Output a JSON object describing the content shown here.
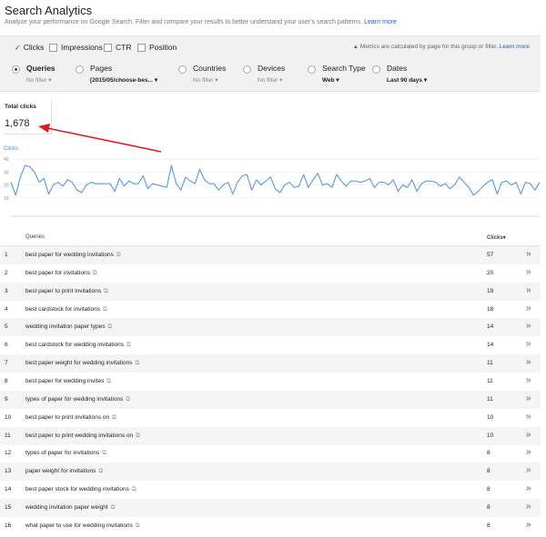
{
  "header": {
    "title": "Search Analytics",
    "subtitle": "Analyze your performance on Google Search. Filter and compare your results to better understand your user's search patterns.",
    "learn_more": "Learn more"
  },
  "metrics": {
    "clicks": "Clicks",
    "impressions": "Impressions",
    "ctr": "CTR",
    "position": "Position",
    "note": "Metrics are calculated by page for this group or filter.",
    "note_link": "Learn more"
  },
  "filters": {
    "queries": {
      "name": "Queries",
      "value": "No filter"
    },
    "pages": {
      "name": "Pages",
      "value": "[2015/05/choose-bes..."
    },
    "countries": {
      "name": "Countries",
      "value": "No filter"
    },
    "devices": {
      "name": "Devices",
      "value": "No filter"
    },
    "search_type": {
      "name": "Search Type",
      "value": "Web"
    },
    "dates": {
      "name": "Dates",
      "value": "Last 90 days"
    }
  },
  "total": {
    "label": "Total clicks",
    "value": "1,678"
  },
  "chart_data": {
    "type": "line",
    "ylabel": "Clicks",
    "yticks": [
      40,
      30,
      20,
      10
    ],
    "ylim": [
      0,
      40
    ],
    "series": [
      {
        "values": [
          22,
          12,
          26,
          35,
          34,
          30,
          22,
          25,
          13,
          20,
          22,
          19,
          24,
          22,
          16,
          14,
          20,
          22,
          21,
          21,
          21,
          21,
          15,
          25,
          19,
          23,
          21,
          21,
          27,
          17,
          21,
          20,
          19,
          18,
          35,
          21,
          16,
          26,
          23,
          21,
          32,
          24,
          21,
          21,
          16,
          20,
          22,
          13,
          22,
          27,
          28,
          16,
          24,
          20,
          23,
          26,
          17,
          14,
          20,
          22,
          18,
          19,
          28,
          18,
          24,
          29,
          20,
          21,
          18,
          28,
          23,
          19,
          23,
          23,
          22,
          23,
          25,
          18,
          22,
          22,
          20,
          24,
          15,
          20,
          18,
          24,
          15,
          21,
          23,
          23,
          22,
          19,
          21,
          17,
          20,
          26,
          22,
          18,
          12,
          15,
          19,
          22,
          24,
          13,
          22,
          23,
          20,
          22,
          13,
          22,
          21,
          16,
          22
        ]
      }
    ]
  },
  "table": {
    "headers": {
      "query": "Queries",
      "clicks": "Clicks"
    },
    "rows": [
      {
        "n": "1",
        "q": "best paper for wedding invitations",
        "c": "57"
      },
      {
        "n": "2",
        "q": "best paper for invitations",
        "c": "20"
      },
      {
        "n": "3",
        "q": "best paper to print invitations",
        "c": "19"
      },
      {
        "n": "4",
        "q": "best cardstock for invitations",
        "c": "18"
      },
      {
        "n": "5",
        "q": "wedding invitation paper types",
        "c": "14"
      },
      {
        "n": "6",
        "q": "best cardstock for wedding invitations",
        "c": "14"
      },
      {
        "n": "7",
        "q": "best paper weight for wedding invitations",
        "c": "11"
      },
      {
        "n": "8",
        "q": "best paper for wedding invites",
        "c": "11"
      },
      {
        "n": "9",
        "q": "types of paper for wedding invitations",
        "c": "11"
      },
      {
        "n": "10",
        "q": "best paper to print invitations on",
        "c": "10"
      },
      {
        "n": "11",
        "q": "best paper to print wedding invitations on",
        "c": "10"
      },
      {
        "n": "12",
        "q": "types of paper for invitations",
        "c": "8"
      },
      {
        "n": "13",
        "q": "paper weight for invitations",
        "c": "8"
      },
      {
        "n": "14",
        "q": "best paper stock for wedding invitations",
        "c": "8"
      },
      {
        "n": "15",
        "q": "wedding invitation paper weight",
        "c": "8"
      },
      {
        "n": "16",
        "q": "what paper to use for wedding invitations",
        "c": "8"
      }
    ]
  },
  "colors": {
    "line": "#4a8fdc",
    "annotation_arrow": "#d81f1f"
  },
  "icons": {
    "row_action": "double-chevron-right-icon",
    "external": "external-link-icon",
    "dropdown": "dropdown-caret-icon"
  }
}
